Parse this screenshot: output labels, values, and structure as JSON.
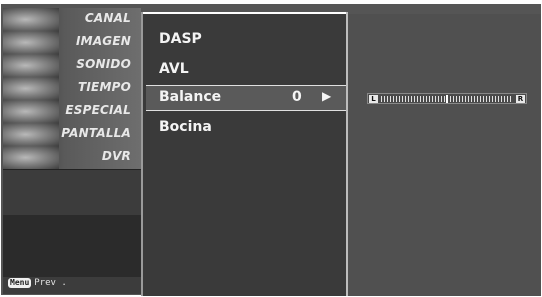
{
  "sidebar": {
    "items": [
      {
        "label": "CANAL",
        "icon": "tv-remote-icon"
      },
      {
        "label": "IMAGEN",
        "icon": "film-reel-icon"
      },
      {
        "label": "SONIDO",
        "icon": "speaker-icon"
      },
      {
        "label": "TIEMPO",
        "icon": "clock-icon"
      },
      {
        "label": "ESPECIAL",
        "icon": "special-tag-icon"
      },
      {
        "label": "PANTALLA",
        "icon": "screen-icon"
      },
      {
        "label": "DVR",
        "icon": "disc-icon"
      }
    ],
    "selected": "SONIDO"
  },
  "footer": {
    "menu_key": "Menu",
    "prev_label": "Prev ."
  },
  "menu": {
    "options": [
      {
        "label": "DASP"
      },
      {
        "label": "AVL"
      },
      {
        "label": "Balance",
        "value": "0",
        "arrow": "▶",
        "selected": true
      },
      {
        "label": "Bocina"
      }
    ]
  },
  "balance_slider": {
    "left_label": "L",
    "right_label": "R",
    "value": 0
  },
  "colors": {
    "panel_dark": "#3a3a3a",
    "panel_mid": "#505050",
    "highlight": "#5a5a5a",
    "text": "#f4f4f4"
  }
}
